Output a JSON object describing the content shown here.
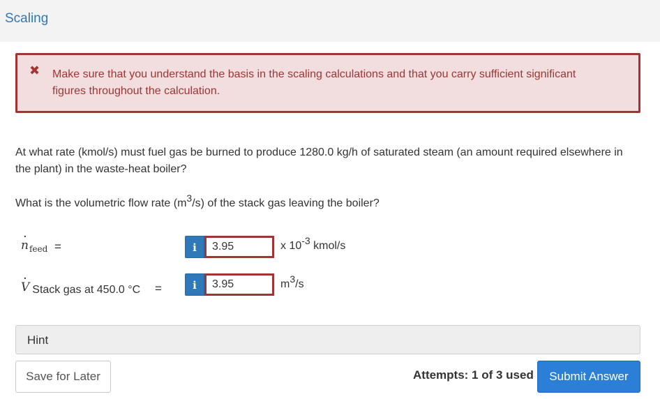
{
  "header": {
    "title": "Scaling"
  },
  "error": {
    "icon": "close-x-icon",
    "message": "Make sure that you understand the basis in the scaling calculations and that you carry sufficient significant figures throughout the calculation."
  },
  "question": {
    "line1": "At what rate (kmol/s) must fuel gas be burned to produce 1280.0 kg/h of saturated steam (an amount required elsewhere in the plant) in the waste-heat boiler?",
    "line2_pre": "What is the volumetric flow rate (m",
    "line2_sup": "3",
    "line2_post": "/s) of the stack gas leaving the boiler?"
  },
  "answers": [
    {
      "symbol": "n",
      "subscript": "feed",
      "equals": "=",
      "info_label": "i",
      "value": "3.95",
      "unit_pre": "x 10",
      "unit_sup": "-3",
      "unit_post": " kmol/s"
    },
    {
      "symbol": "V",
      "label": "Stack gas at 450.0 °C",
      "equals": "=",
      "info_label": "i",
      "value": "3.95",
      "unit_pre": "m",
      "unit_sup": "3",
      "unit_post": "/s"
    }
  ],
  "hint": {
    "label": "Hint"
  },
  "footer": {
    "save_label": "Save for Later",
    "attempts_text": "Attempts: 1 of 3 used",
    "submit_label": "Submit Answer"
  },
  "colors": {
    "link_blue": "#2f79b9",
    "error_red": "#a23434",
    "error_bg": "#f2dede",
    "submit_blue": "#2c7fd6"
  }
}
